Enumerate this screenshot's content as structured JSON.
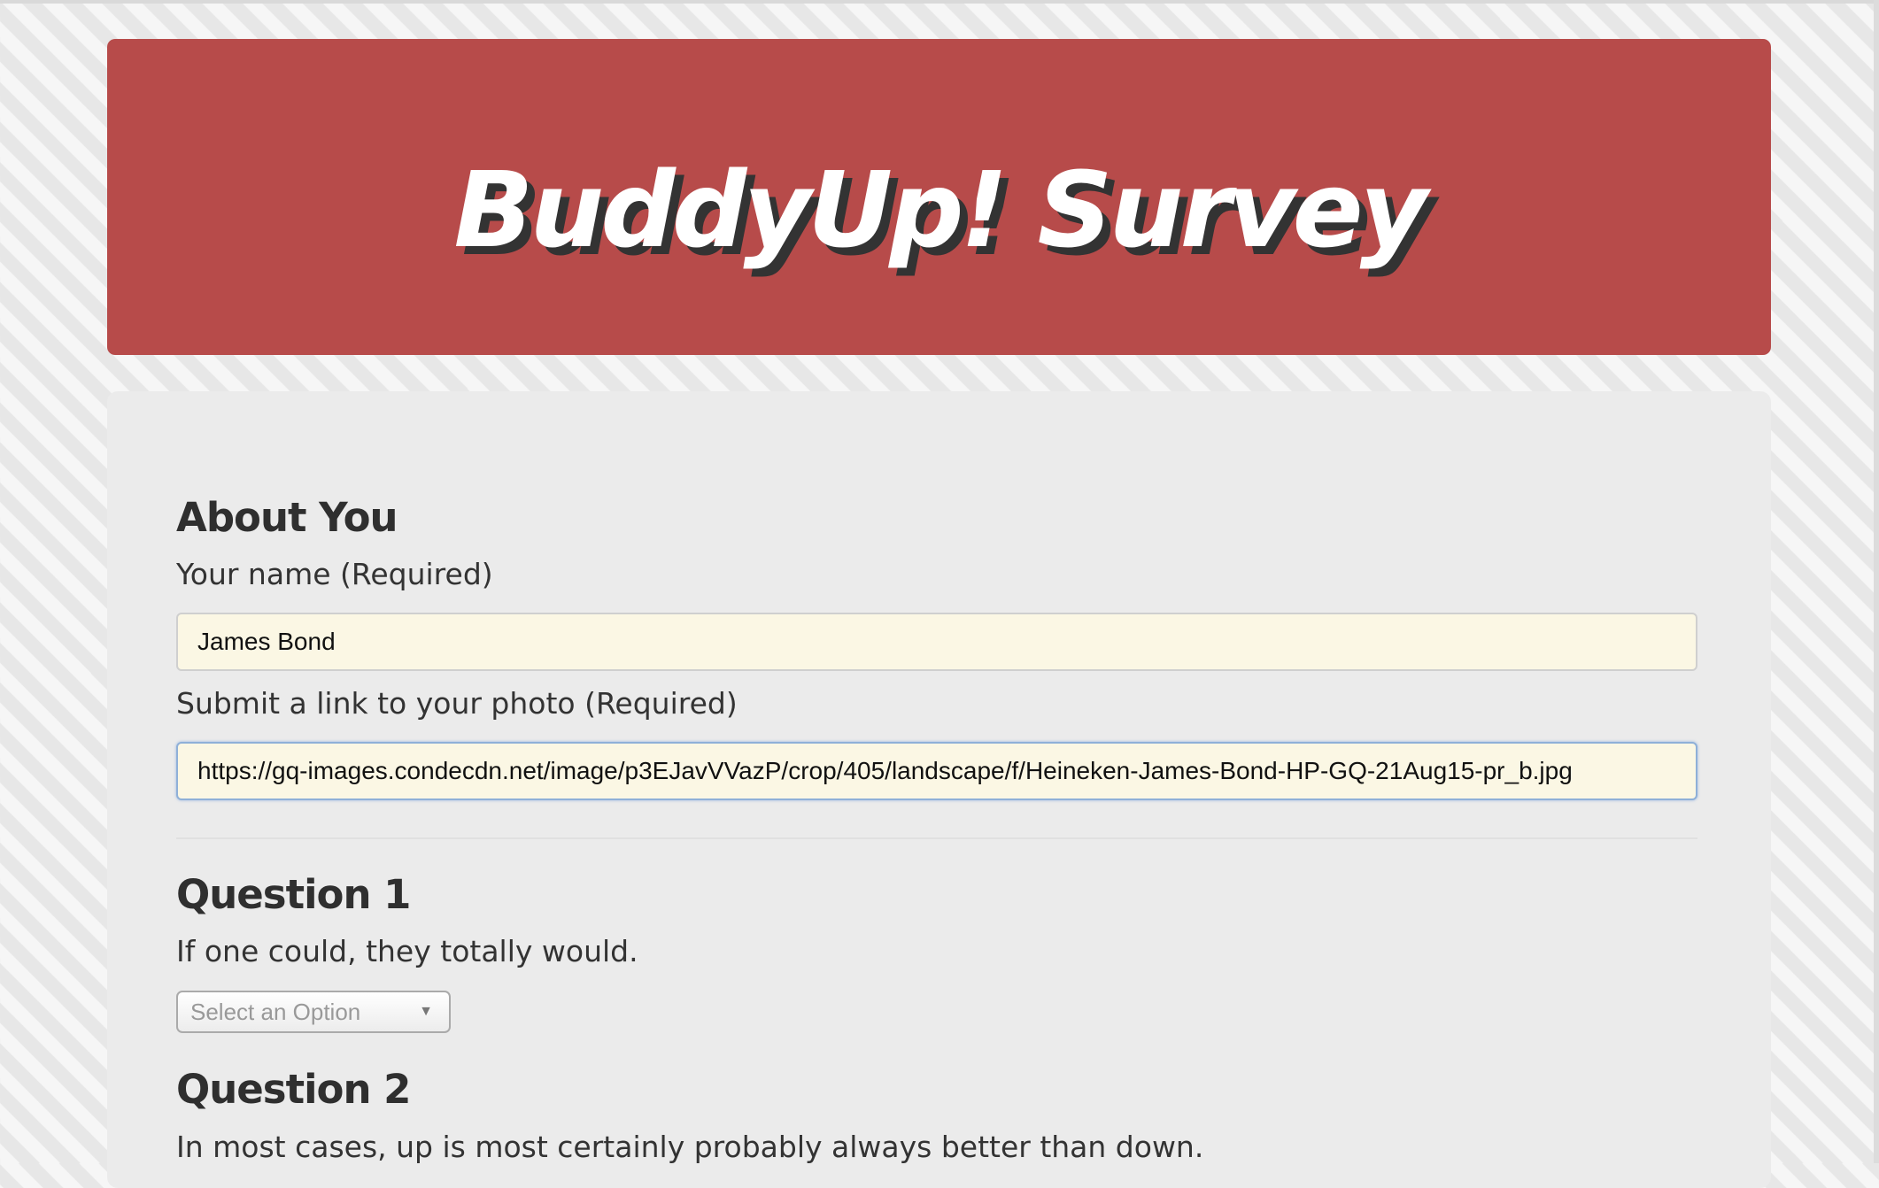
{
  "header": {
    "title": "BuddyUp! Survey"
  },
  "about": {
    "title": "About You",
    "name_label": "Your name (Required)",
    "name_value": "James Bond",
    "photo_label": "Submit a link to your photo (Required)",
    "photo_value": "https://gq-images.condecdn.net/image/p3EJavVVazP/crop/405/landscape/f/Heineken-James-Bond-HP-GQ-21Aug15-pr_b.jpg"
  },
  "questions": [
    {
      "title": "Question 1",
      "text": "If one could, they totally would.",
      "select_value": "Select an Option"
    },
    {
      "title": "Question 2",
      "text": "In most cases, up is most certainly probably always better than down."
    }
  ],
  "icons": {
    "select_caret": "chevron-down-icon"
  },
  "colors": {
    "header_bg": "#b74b4a",
    "panel_bg": "#ebebeb",
    "input_bg": "#fbf7e4"
  }
}
